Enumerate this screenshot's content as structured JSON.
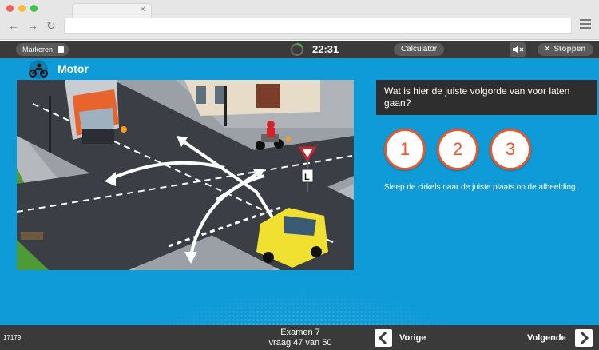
{
  "toolbar": {
    "mark_label": "Markeren",
    "timer": "22:31",
    "calculator_label": "Calculator",
    "mute_icon": "speaker-mute-icon",
    "stop_label": "Stoppen"
  },
  "category": {
    "icon": "motorcycle-icon",
    "title": "Motor"
  },
  "question": {
    "text": "Wat is hier de juiste volgorde van voor laten gaan?",
    "options": [
      "1",
      "2",
      "3"
    ],
    "instruction": "Sleep de cirkels naar de juiste plaats op de afbeelding."
  },
  "footer": {
    "question_id": "17179",
    "exam_title": "Examen 7",
    "progress": "vraag 47 van 50",
    "prev_label": "Vorige",
    "next_label": "Volgende"
  },
  "colors": {
    "main_bg": "#0f9bd7",
    "bar_bg": "#3a3a3a",
    "circle_accent": "#e8562a"
  }
}
